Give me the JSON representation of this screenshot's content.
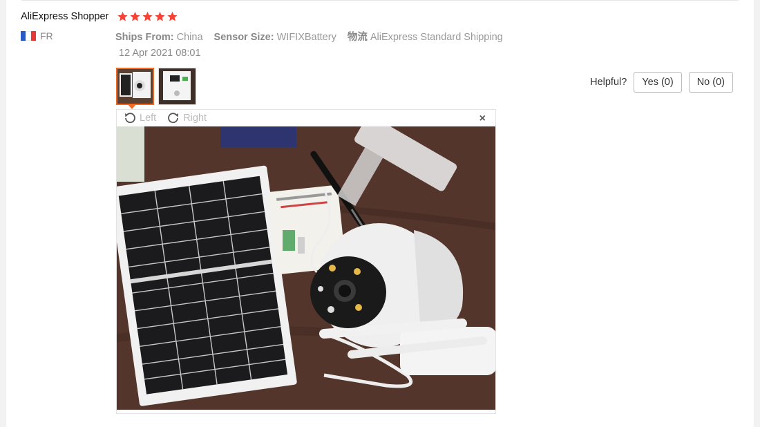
{
  "review": {
    "user_name": "AliExpress Shopper",
    "country_code": "FR",
    "rating": 5,
    "ships_from_label": "Ships From:",
    "ships_from_value": "China",
    "sensor_size_label": "Sensor Size:",
    "sensor_size_value": "WIFIXBattery",
    "logistics_label": "物流",
    "logistics_value": "AliExpress Standard Shipping",
    "date": "12 Apr 2021 08:01"
  },
  "helpful": {
    "label": "Helpful?",
    "yes": "Yes (0)",
    "no": "No (0)"
  },
  "viewer": {
    "rotate_left": "Left",
    "rotate_right": "Right",
    "close": "×"
  },
  "colors": {
    "star": "#f44336",
    "active_thumb": "#f46a25",
    "flag_blue": "#2b59c3",
    "flag_white": "#ffffff",
    "flag_red": "#e53935"
  },
  "icons": {
    "star": "star-icon",
    "rotate_left": "rotate-left-icon",
    "rotate_right": "rotate-right-icon",
    "close": "close-icon",
    "flag": "flag-france-icon"
  }
}
